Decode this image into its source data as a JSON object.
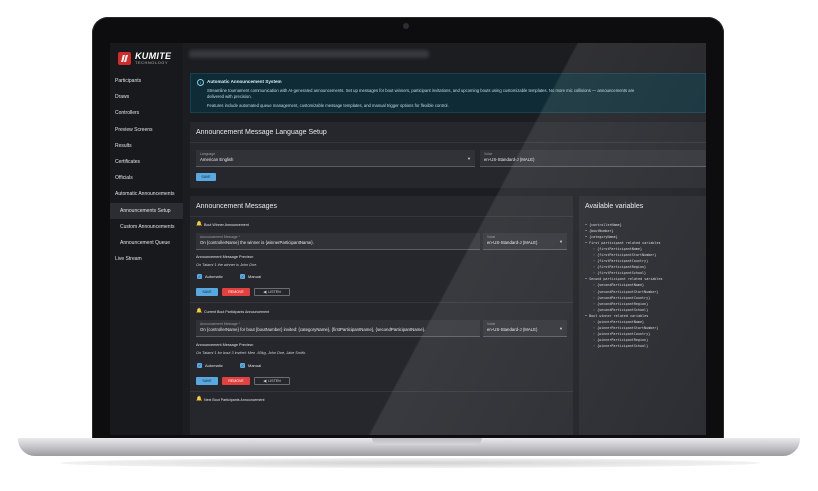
{
  "app": {
    "logo": {
      "name": "KUMITE",
      "sub": "TECHNOLOGY"
    }
  },
  "sidebar": {
    "items": [
      {
        "label": "Participants"
      },
      {
        "label": "Draws"
      },
      {
        "label": "Controllers"
      },
      {
        "label": "Preview Screens"
      },
      {
        "label": "Results"
      },
      {
        "label": "Certificates"
      },
      {
        "label": "Officials"
      },
      {
        "label": "Automatic Announcements"
      },
      {
        "label": "Announcements Setup",
        "active": true,
        "sub": true
      },
      {
        "label": "Custom Announcements",
        "sub": true
      },
      {
        "label": "Announcement Queue",
        "sub": true
      },
      {
        "label": "Live Stream"
      }
    ]
  },
  "info": {
    "title": "Automatic Announcement System",
    "line1": "Streamline tournament communication with AI-generated announcements. Set up messages for bout winners, participant invitations, and upcoming bouts using customizable templates. No more mic collisions — announcements are",
    "line2": "delivered with precision.",
    "line3": "Features include automated queue management, customizable message templates, and manual trigger options for flexible control."
  },
  "language_setup": {
    "title": "Announcement Message Language Setup",
    "language_label": "Language",
    "language_value": "American English",
    "voice_label": "Voice",
    "voice_value": "en-US-Standard-J (MALE)",
    "save_label": "SAVE"
  },
  "messages": {
    "title": "Announcement Messages",
    "bout_winner": {
      "heading": "Bout Winner Announcement",
      "message_label": "Announcement Message *",
      "message_value": "On {controllerName} the winner is {winnerParticipantName}.",
      "voice_label": "Voice",
      "voice_value": "en-US-Standard-J (MALE)",
      "preview_title": "Announcement Message Preview:",
      "preview_text": "On Tatami 1 the winner is John Doe.",
      "automatic_label": "Automatic",
      "manual_label": "Manual",
      "save_label": "SAVE",
      "remove_label": "REMOVE",
      "listen_label": "LISTEN"
    },
    "current_bout": {
      "heading": "Current Bout Participants Announcement",
      "message_label": "Announcement Message *",
      "message_value": "On {controllerName} for bout {boutNumber} invited: {categoryName}, {firstParticipantName}, {secondParticipantName}.",
      "voice_label": "Voice",
      "voice_value": "en-US-Standard-J (MALE)",
      "preview_title": "Announcement Message Preview:",
      "preview_text": "On Tatami 1 for bout 3 invited: Men -60kg, John Doe, Jake Smith.",
      "automatic_label": "Automatic",
      "manual_label": "Manual",
      "save_label": "SAVE",
      "remove_label": "REMOVE",
      "listen_label": "LISTEN"
    },
    "next_bout": {
      "heading": "Next Bout Participants Announcement"
    }
  },
  "variables": {
    "title": "Available variables",
    "lines": [
      {
        "text": "• {controllerName}",
        "indent": false
      },
      {
        "text": "• {boutNumber}",
        "indent": false
      },
      {
        "text": "• {categoryName}",
        "indent": false
      },
      {
        "text": "• First participant related variables",
        "indent": false
      },
      {
        "text": "◦ {firstParticipantName}",
        "indent": true
      },
      {
        "text": "◦ {firstParticipantStartNumber}",
        "indent": true
      },
      {
        "text": "◦ {firstParticipantCountry}",
        "indent": true
      },
      {
        "text": "◦ {firstParticipantRegion}",
        "indent": true
      },
      {
        "text": "◦ {firstParticipantSchool}",
        "indent": true
      },
      {
        "text": "• Second participant related variables",
        "indent": false
      },
      {
        "text": "◦ {secondParticipantName}",
        "indent": true
      },
      {
        "text": "◦ {secondParticipantStartNumber}",
        "indent": true
      },
      {
        "text": "◦ {secondParticipantCountry}",
        "indent": true
      },
      {
        "text": "◦ {secondParticipantRegion}",
        "indent": true
      },
      {
        "text": "◦ {secondParticipantSchool}",
        "indent": true
      },
      {
        "text": "• Bout winner related variables",
        "indent": false
      },
      {
        "text": "◦ {winnerParticipantName}",
        "indent": true
      },
      {
        "text": "◦ {winnerParticipantStartNumber}",
        "indent": true
      },
      {
        "text": "◦ {winnerParticipantCountry}",
        "indent": true
      },
      {
        "text": "◦ {winnerParticipantRegion}",
        "indent": true
      },
      {
        "text": "◦ {winnerParticipantSchool}",
        "indent": true
      }
    ]
  },
  "colors": {
    "accent": "#58a9e0",
    "danger": "#e2413e",
    "logo": "#d42a2a",
    "info_bg": "#0f2c36"
  }
}
